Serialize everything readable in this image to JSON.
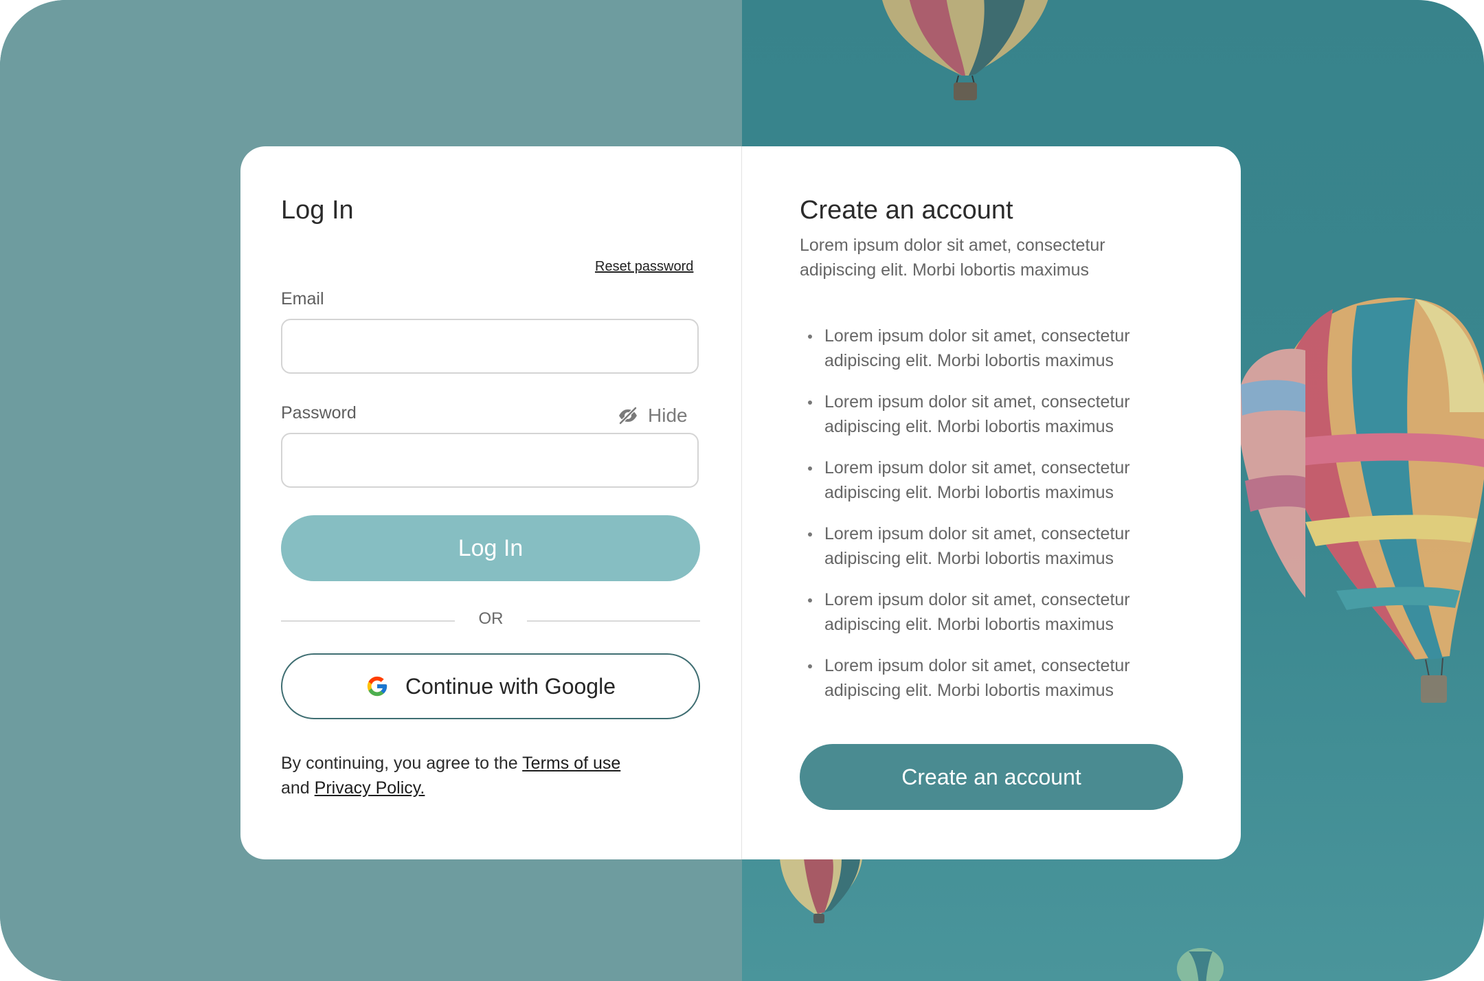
{
  "login": {
    "title": "Log In",
    "reset_label": "Reset password",
    "email_label": "Email",
    "email_value": "",
    "password_label": "Password",
    "password_value": "",
    "hide_label": "Hide",
    "submit_label": "Log In",
    "or_label": "OR",
    "google_label": "Continue with Google",
    "legal_prefix": "By continuing, you agree to the ",
    "terms_label": "Terms of use",
    "legal_and": "and ",
    "privacy_label": "Privacy Policy."
  },
  "signup": {
    "title": "Create an account",
    "subtitle": "Lorem ipsum dolor sit amet, consectetur adipiscing elit. Morbi lobortis maximus",
    "benefits": [
      "Lorem ipsum dolor sit amet, consectetur adipiscing elit. Morbi lobortis maximus",
      "Lorem ipsum dolor sit amet, consectetur adipiscing elit. Morbi lobortis maximus",
      "Lorem ipsum dolor sit amet, consectetur adipiscing elit. Morbi lobortis maximus",
      "Lorem ipsum dolor sit amet, consectetur adipiscing elit. Morbi lobortis maximus",
      "Lorem ipsum dolor sit amet, consectetur adipiscing elit. Morbi lobortis maximus",
      "Lorem ipsum dolor sit amet, consectetur adipiscing elit. Morbi lobortis maximus"
    ],
    "button_label": "Create an account"
  },
  "icons": {
    "hide": "eye-off-icon",
    "google": "google-logo-icon"
  },
  "colors": {
    "left_background": "#6e9c9f",
    "sky": "#38838b",
    "login_button": "#86bec2",
    "create_button": "#4a8b91",
    "google_border": "#3f6e72"
  }
}
